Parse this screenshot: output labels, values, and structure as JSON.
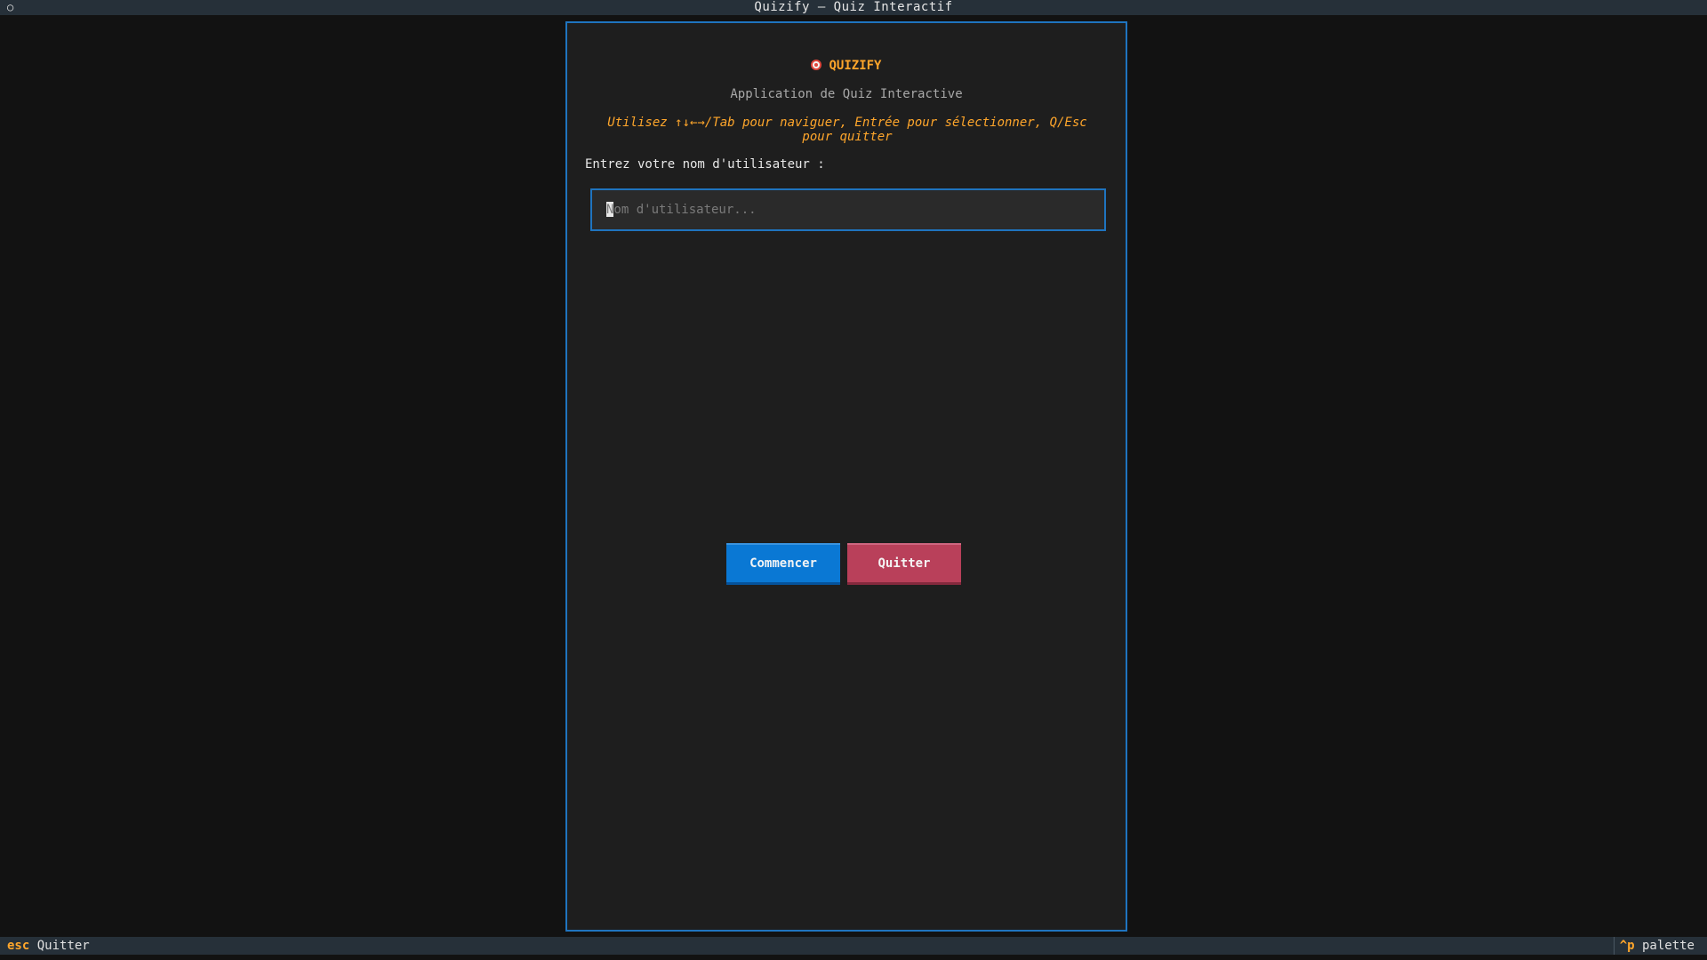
{
  "window": {
    "title": "Quizify – Quiz Interactif",
    "icon": "circle-icon"
  },
  "app": {
    "title": "QUIZIFY",
    "title_icon": "target-icon",
    "subtitle": "Application de Quiz Interactive",
    "instructions": "Utilisez ↑↓←→/Tab pour naviguer, Entrée pour sélectionner, Q/Esc pour quitter"
  },
  "login": {
    "label": "Entrez votre nom d'utilisateur :",
    "value": "",
    "placeholder": "Nom d'utilisateur..."
  },
  "buttons": {
    "start": "Commencer",
    "quit": "Quitter"
  },
  "footer": {
    "left_key": "esc",
    "left_label": "Quitter",
    "right_key": "^p",
    "right_label": "palette"
  },
  "colors": {
    "accent": "#ffa62b",
    "border": "#1f74bf",
    "primary_button": "#0a78d4",
    "danger_button": "#b9405a"
  }
}
